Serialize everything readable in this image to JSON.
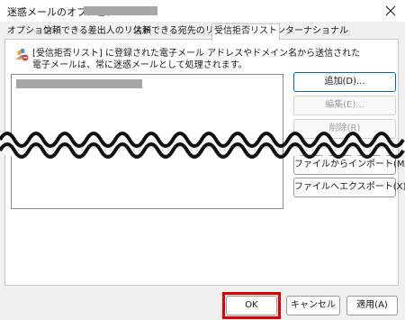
{
  "window": {
    "title": "迷惑メールのオプション -"
  },
  "tabs": [
    {
      "label": "オプション",
      "active": false
    },
    {
      "label": "信頼できる差出人のリスト",
      "active": false
    },
    {
      "label": "信頼できる宛先のリスト",
      "active": false
    },
    {
      "label": "受信拒否リスト",
      "active": true
    },
    {
      "label": "インターナショナル",
      "active": false
    }
  ],
  "info": {
    "icon": "blocked-senders-icon",
    "line1": "[受信拒否リスト] に登録された電子メール アドレスやドメイン名から送信された",
    "line2": "電子メールは、常に迷惑メールとして処理されます。"
  },
  "side_buttons": {
    "add": "追加(D)...",
    "edit": "編集(E)...",
    "remove": "削除(R)",
    "import": "ファイルからインポート(M)...",
    "export": "ファイルへエクスポート(X)..."
  },
  "footer": {
    "ok": "OK",
    "cancel": "キャンセル",
    "apply": "適用(A)"
  },
  "colors": {
    "highlight": "#e00000",
    "redaction": "#a6a6a6",
    "focus_border": "#0067c0"
  }
}
